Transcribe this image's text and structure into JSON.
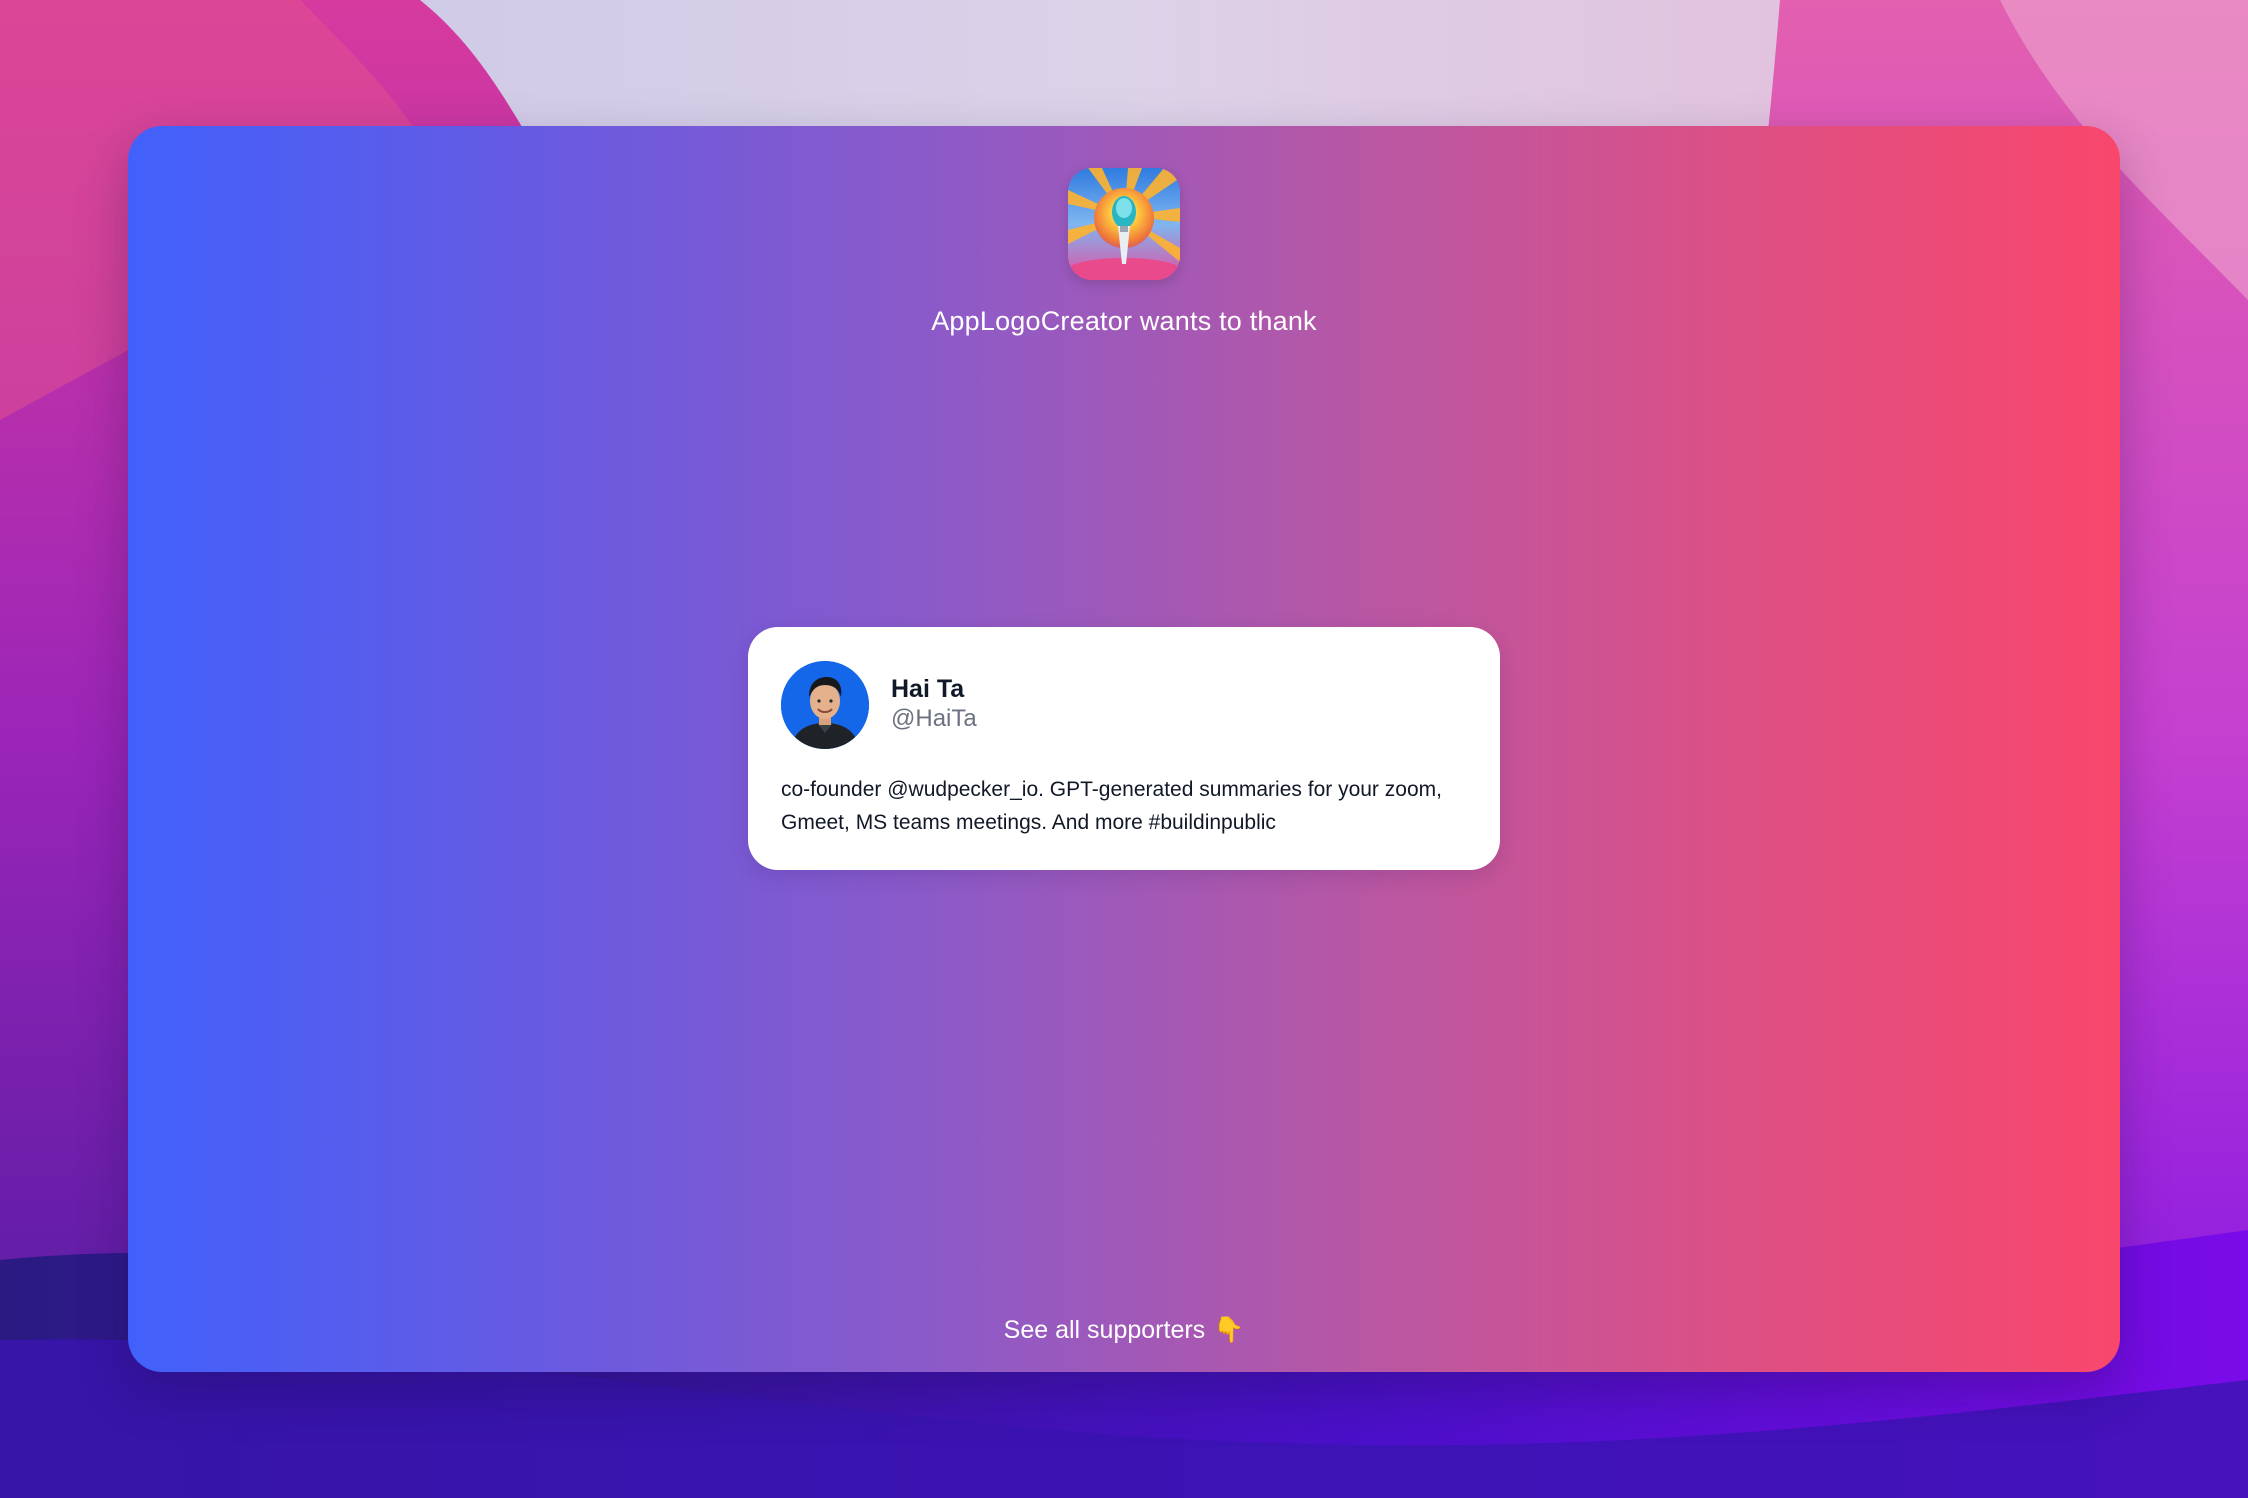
{
  "page": {
    "app_name": "AppLogoCreator",
    "thank_title": "AppLogoCreator wants to thank",
    "app_logo_icon": "paintbrush-sunburst-icon"
  },
  "supporter": {
    "name": "Hai Ta",
    "handle": "@HaiTa",
    "bio": "co-founder @wudpecker_io. GPT-generated summaries for your zoom, Gmeet, MS teams meetings. And more #buildinpublic",
    "avatar_icon": "user-avatar"
  },
  "footer": {
    "see_all_label": "See all supporters",
    "see_all_icon": "pointing-down-icon",
    "see_all_glyph": "👇"
  },
  "colors": {
    "card_gradient_start": "#4160fb",
    "card_gradient_end": "#f9476c",
    "text_primary": "#111827",
    "text_secondary": "#6b7280"
  }
}
